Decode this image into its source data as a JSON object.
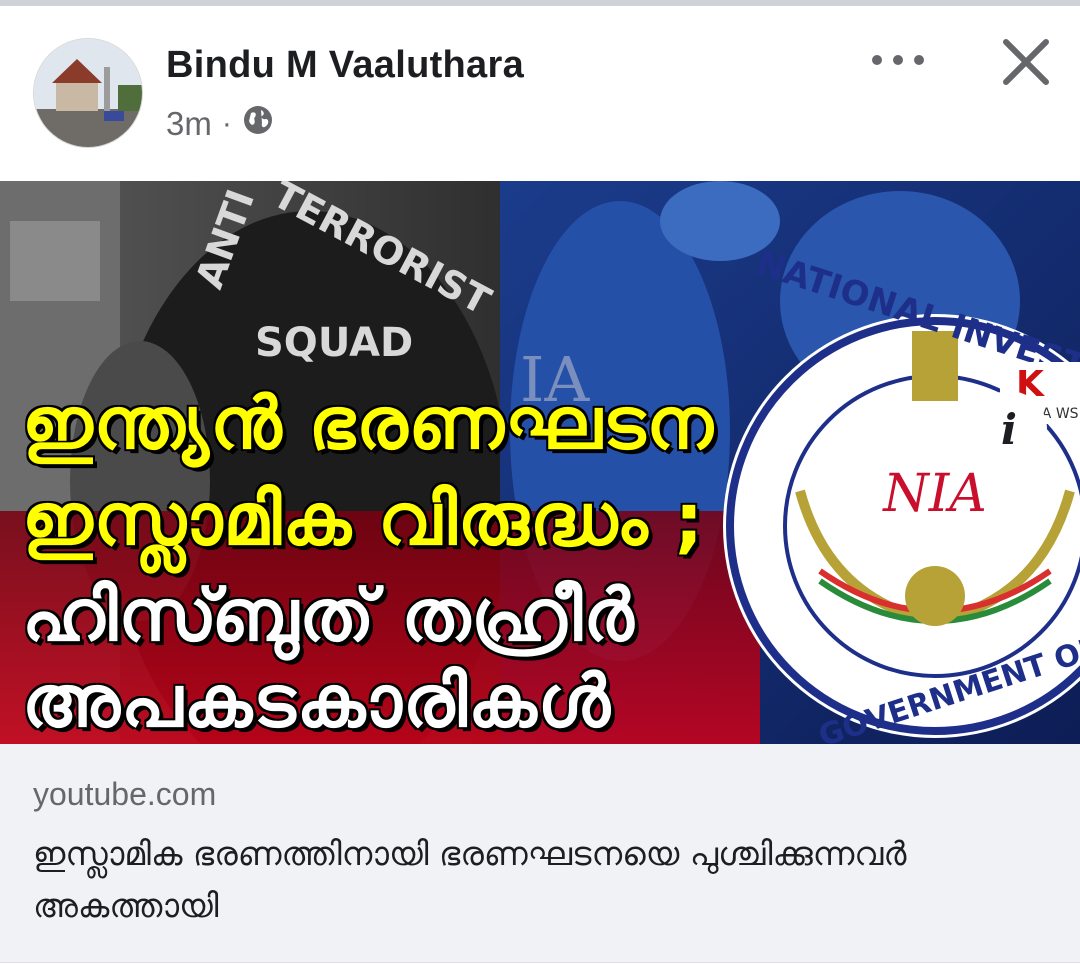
{
  "post": {
    "author": "Bindu M Vaaluthara",
    "time": "3m",
    "separator": "·",
    "audience_icon": "globe-icon",
    "more_icon": "more-options-icon",
    "close_icon": "close-icon"
  },
  "thumbnail": {
    "vest_text": [
      "ANTI",
      "TERRORIST",
      "SQUAD"
    ],
    "seal_text_top": "NATIONAL INVESTIGATION",
    "seal_text_bottom": "GOVERNMENT OF INDIA",
    "seal_abbr": "NIA",
    "background_letters": "IA",
    "brand_letter": "K",
    "brand_text": "RMA WS",
    "headline_lines": [
      "ഇന്ത്യൻ ഭരണഘടന",
      "ഇസ്ലാമിക വിരുദ്ധം ;",
      "ഹിസ്ബുത് തഹ്രീർ",
      "അപകടകാരികൾ"
    ],
    "info_label": "i"
  },
  "link": {
    "domain": "youtube.com",
    "title": "ഇസ്ലാമിക ഭരണത്തിനായി ഭരണഘടനയെ പുശ്ചിക്കുന്നവർ അകത്തായി"
  },
  "colors": {
    "headline_yellow": "#ffff00",
    "headline_white": "#ffffff",
    "red_band": "#c4001a",
    "seal_blue": "#1e2f8a"
  }
}
